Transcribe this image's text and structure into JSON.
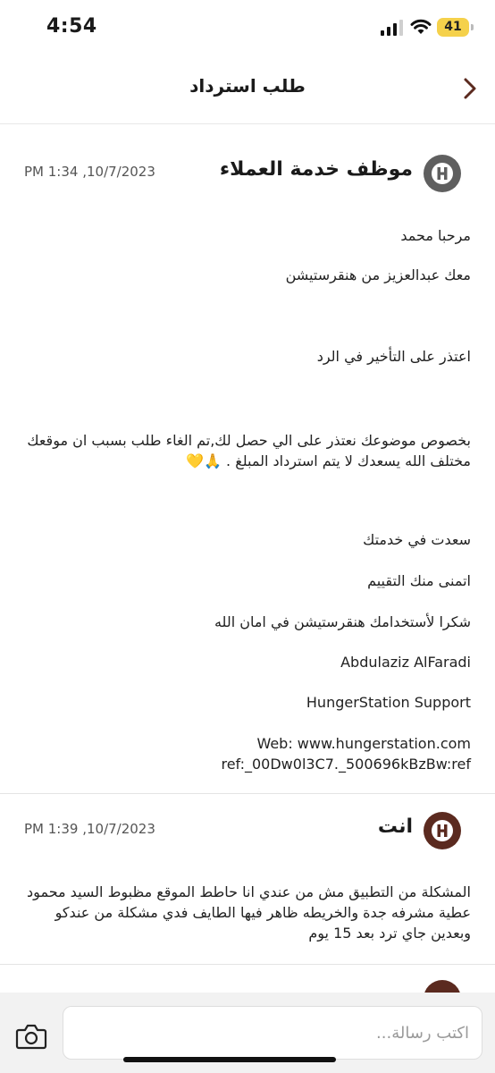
{
  "status_bar": {
    "time": "4:54",
    "battery": "41"
  },
  "nav": {
    "title": "طلب استرداد"
  },
  "messages": [
    {
      "sender": "موظف خدمة العملاء",
      "timestamp": "PM 1:34 ,10/7/2023",
      "avatar_letter": "H",
      "lines": [
        "مرحبا محمد",
        "معك عبدالعزيز من هنقرستيشن",
        "اعتذر على التأخير في الرد",
        "بخصوص موضوعك نعتذر على الي حصل لك,تم الغاء طلب بسبب ان موقعك مختلف الله يسعدك لا يتم استرداد المبلغ . 🙏💛",
        "سعدت في خدمتك",
        "اتمنى منك التقييم",
        "شكرا لأستخدامك هنقرستيشن في امان الله",
        "Abdulaziz AlFaradi",
        "HungerStation Support",
        "Web: www.hungerstation.com",
        "ref:_00Dw0l3C7._500696kBzBw:ref"
      ]
    },
    {
      "sender": "انت",
      "timestamp": "PM 1:39 ,10/7/2023",
      "avatar_letter": "H",
      "lines": [
        "المشكلة من التطبيق مش من عندي انا حاطط الموقع مظبوط السيد محمود عطية مشرفه جدة والخريطه ظاهر فيها الطايف فدي مشكلة من عندكو وبعدين جاي ترد بعد 15 يوم"
      ]
    }
  ],
  "composer": {
    "placeholder": "اكتب رسالة..."
  },
  "colors": {
    "accent": "#5b2a1f",
    "agent_avatar": "#5f5f5f"
  }
}
